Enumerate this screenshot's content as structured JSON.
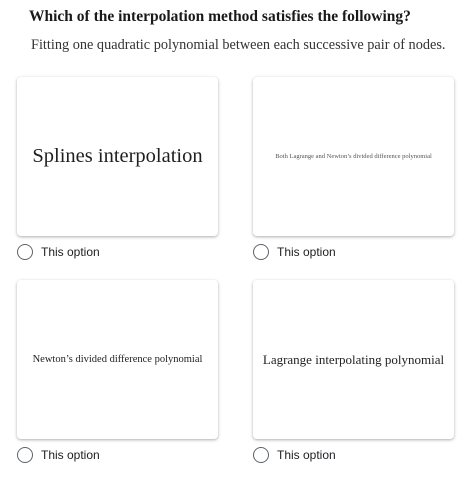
{
  "question": {
    "title": "Which of the interpolation method satisfies the following?",
    "description": "Fitting one quadratic polynomial between each successive pair of nodes."
  },
  "options": [
    {
      "card_text": "Splines interpolation",
      "label": "This option",
      "selected": false
    },
    {
      "card_text": "Both Lagrange and Newton’s divided difference polynomial",
      "label": "This option",
      "selected": false
    },
    {
      "card_text": "Newton’s divided difference polynomial",
      "label": "This option",
      "selected": false
    },
    {
      "card_text": "Lagrange interpolating polynomial",
      "label": "This option",
      "selected": false
    }
  ],
  "colors": {
    "radio_border": "#5f6368",
    "card_shadow": "#3c4043",
    "text": "#202124"
  }
}
